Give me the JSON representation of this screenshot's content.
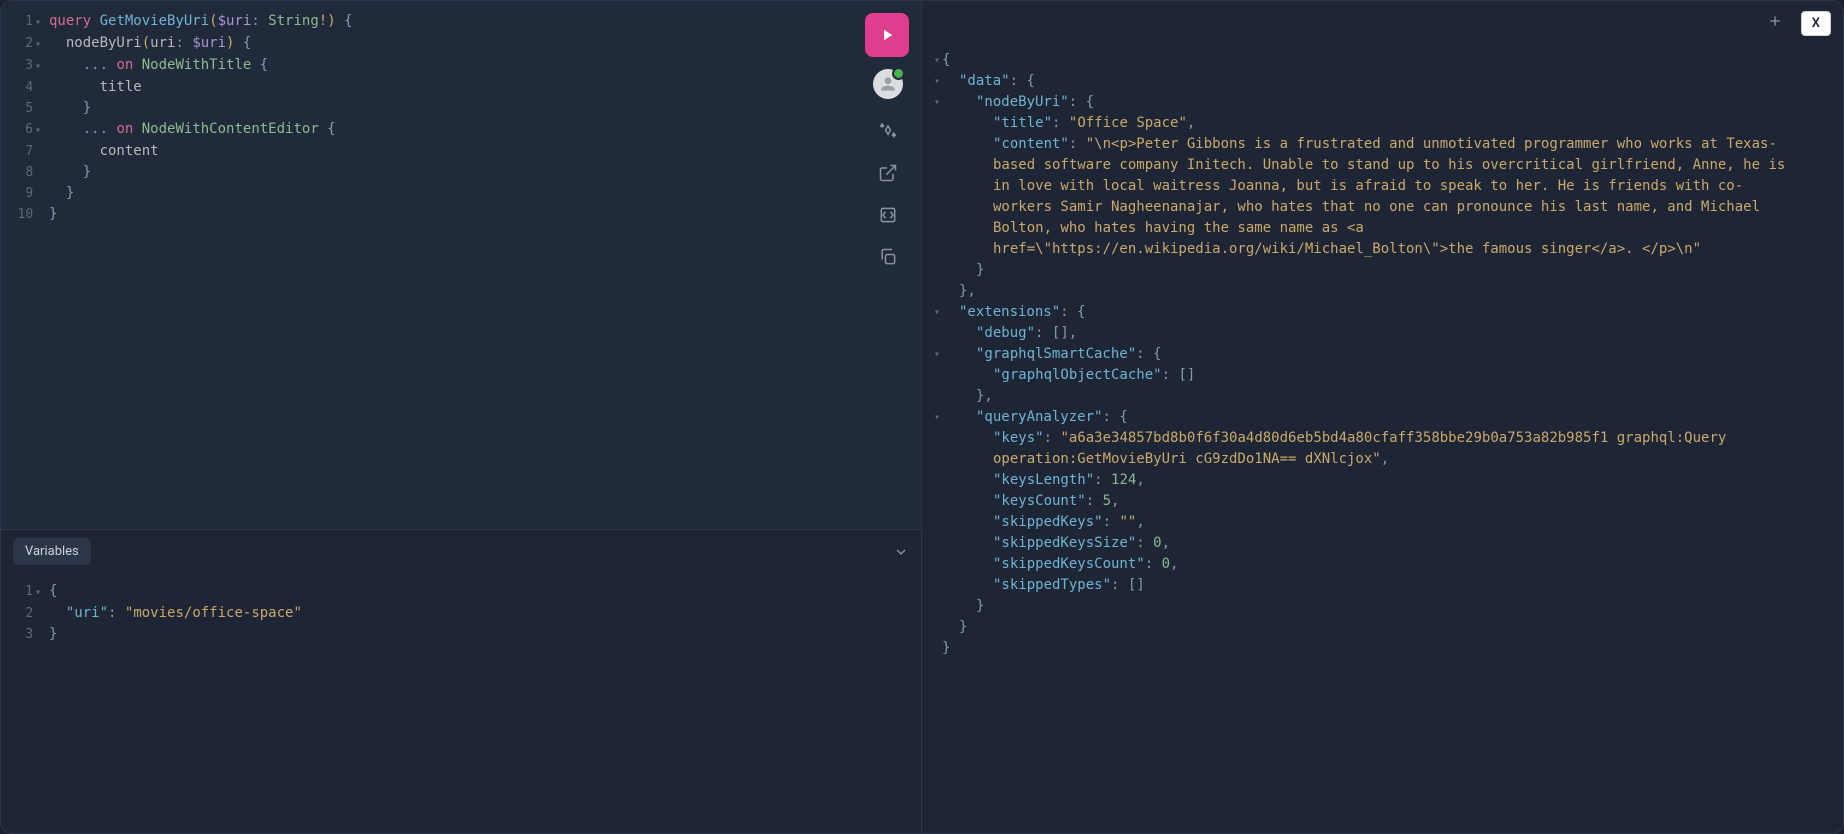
{
  "query_lines": [
    {
      "html": "<span class='kw-query'>query</span> <span class='def-name'>GetMovieByUri</span><span class='paren'>(</span><span class='var-name'>$uri</span><span class='punct'>:</span> <span class='type-name'>String</span><span class='exclaim'>!</span><span class='paren'>)</span> <span class='brace'>{</span>",
      "fold": true
    },
    {
      "html": "  <span class='field'>nodeByUri</span><span class='paren'>(</span><span class='field'>uri</span><span class='punct'>:</span> <span class='var-name'>$uri</span><span class='paren'>)</span> <span class='brace'>{</span>",
      "fold": true
    },
    {
      "html": "    <span class='spread'>...</span> <span class='kw-on'>on</span> <span class='type-name'>NodeWithTitle</span> <span class='brace'>{</span>",
      "fold": true
    },
    {
      "html": "      <span class='field'>title</span>",
      "fold": false
    },
    {
      "html": "    <span class='brace'>}</span>",
      "fold": false
    },
    {
      "html": "    <span class='spread'>...</span> <span class='kw-on'>on</span> <span class='type-name'>NodeWithContentEditor</span> <span class='brace'>{</span>",
      "fold": true
    },
    {
      "html": "      <span class='field'>content</span>",
      "fold": false
    },
    {
      "html": "    <span class='brace'>}</span>",
      "fold": false
    },
    {
      "html": "  <span class='brace'>}</span>",
      "fold": false
    },
    {
      "html": "<span class='brace'>}</span>",
      "fold": false
    }
  ],
  "variables_label": "Variables",
  "variables_lines": [
    {
      "html": "<span class='brace'>{</span>",
      "fold": true
    },
    {
      "html": "  <span class='json-key'>\"uri\"</span><span class='json-punct'>:</span> <span class='json-string'>\"movies/office-space\"</span>",
      "fold": false
    },
    {
      "html": "<span class='brace'>}</span>",
      "fold": false
    }
  ],
  "close_label": "X",
  "response": {
    "data": {
      "nodeByUri": {
        "title": "Office Space",
        "content": "\\n<p>Peter Gibbons is a frustrated and unmotivated programmer who works at Texas-based software company Initech. Unable to stand up to his overcritical girlfriend, Anne, he is in love with local waitress Joanna, but is afraid to speak to her. He is friends with co-workers Samir Nagheenanajar, who hates that no one can pronounce his last name, and Michael Bolton, who hates having the same name as <a href=\\\"https://en.wikipedia.org/wiki/Michael_Bolton\\\">the famous singer</a>. </p>\\n"
      }
    },
    "extensions": {
      "debug": [],
      "graphqlSmartCache": {
        "graphqlObjectCache": []
      },
      "queryAnalyzer": {
        "keys": "a6a3e34857bd8b0f6f30a4d80d6eb5bd4a80cfaff358bbe29b0a753a82b985f1 graphql:Query operation:GetMovieByUri cG9zdDo1NA== dXNlcjox",
        "keysLength": 124,
        "keysCount": 5,
        "skippedKeys": "",
        "skippedKeysSize": 0,
        "skippedKeysCount": 0,
        "skippedTypes": []
      }
    }
  },
  "response_lines": [
    {
      "indent": 0,
      "fold": true,
      "html": "<span class='json-punct'>{</span>"
    },
    {
      "indent": 1,
      "fold": true,
      "html": "<span class='json-key'>\"data\"</span><span class='json-punct'>:</span> <span class='json-punct'>{</span>"
    },
    {
      "indent": 2,
      "fold": true,
      "html": "<span class='json-key'>\"nodeByUri\"</span><span class='json-punct'>:</span> <span class='json-punct'>{</span>"
    },
    {
      "indent": 3,
      "fold": false,
      "html": "<span class='json-key'>\"title\"</span><span class='json-punct'>:</span> <span class='json-string'>\"Office Space\"</span><span class='json-punct'>,</span>"
    },
    {
      "indent": 3,
      "fold": false,
      "content_key": true
    },
    {
      "indent": 2,
      "fold": false,
      "html": "<span class='json-punct'>}</span>"
    },
    {
      "indent": 1,
      "fold": false,
      "html": "<span class='json-punct'>},</span>"
    },
    {
      "indent": 1,
      "fold": true,
      "html": "<span class='json-key'>\"extensions\"</span><span class='json-punct'>:</span> <span class='json-punct'>{</span>"
    },
    {
      "indent": 2,
      "fold": false,
      "html": "<span class='json-key'>\"debug\"</span><span class='json-punct'>:</span> <span class='json-punct'>[]</span><span class='json-punct'>,</span>"
    },
    {
      "indent": 2,
      "fold": true,
      "html": "<span class='json-key'>\"graphqlSmartCache\"</span><span class='json-punct'>:</span> <span class='json-punct'>{</span>"
    },
    {
      "indent": 3,
      "fold": false,
      "html": "<span class='json-key'>\"graphqlObjectCache\"</span><span class='json-punct'>:</span> <span class='json-punct'>[]</span>"
    },
    {
      "indent": 2,
      "fold": false,
      "html": "<span class='json-punct'>},</span>"
    },
    {
      "indent": 2,
      "fold": true,
      "html": "<span class='json-key'>\"queryAnalyzer\"</span><span class='json-punct'>:</span> <span class='json-punct'>{</span>"
    },
    {
      "indent": 3,
      "fold": false,
      "keys_key": true
    },
    {
      "indent": 3,
      "fold": false,
      "html": "<span class='json-key'>\"keysLength\"</span><span class='json-punct'>:</span> <span class='json-num'>124</span><span class='json-punct'>,</span>"
    },
    {
      "indent": 3,
      "fold": false,
      "html": "<span class='json-key'>\"keysCount\"</span><span class='json-punct'>:</span> <span class='json-num'>5</span><span class='json-punct'>,</span>"
    },
    {
      "indent": 3,
      "fold": false,
      "html": "<span class='json-key'>\"skippedKeys\"</span><span class='json-punct'>:</span> <span class='json-string'>\"\"</span><span class='json-punct'>,</span>"
    },
    {
      "indent": 3,
      "fold": false,
      "html": "<span class='json-key'>\"skippedKeysSize\"</span><span class='json-punct'>:</span> <span class='json-num'>0</span><span class='json-punct'>,</span>"
    },
    {
      "indent": 3,
      "fold": false,
      "html": "<span class='json-key'>\"skippedKeysCount\"</span><span class='json-punct'>:</span> <span class='json-num'>0</span><span class='json-punct'>,</span>"
    },
    {
      "indent": 3,
      "fold": false,
      "html": "<span class='json-key'>\"skippedTypes\"</span><span class='json-punct'>:</span> <span class='json-punct'>[]</span>"
    },
    {
      "indent": 2,
      "fold": false,
      "html": "<span class='json-punct'>}</span>"
    },
    {
      "indent": 1,
      "fold": false,
      "html": "<span class='json-punct'>}</span>"
    },
    {
      "indent": 0,
      "fold": false,
      "html": "<span class='json-punct'>}</span>"
    }
  ]
}
